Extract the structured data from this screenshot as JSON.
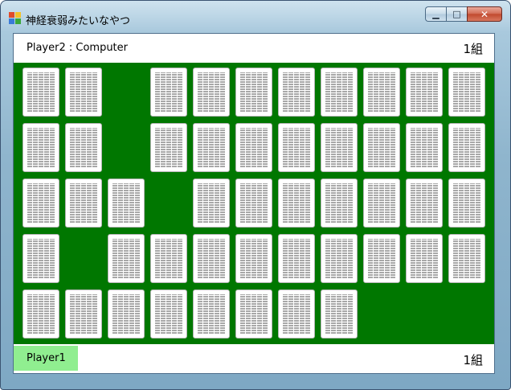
{
  "window": {
    "title": "神経衰弱みたいなやつ",
    "controls": {
      "minimize": "▁",
      "maximize": "□",
      "close": "✕"
    }
  },
  "top_bar": {
    "players_label": "Player2 : Computer",
    "pairs": "1組"
  },
  "bottom_bar": {
    "current_player": "Player1",
    "current_player_color": "#90ee90",
    "pairs": "1組"
  },
  "board": {
    "background_color": "#007700",
    "rows": 5,
    "cols": 11,
    "grid": [
      [
        1,
        1,
        0,
        1,
        1,
        1,
        1,
        1,
        1,
        1,
        1
      ],
      [
        1,
        1,
        0,
        1,
        1,
        1,
        1,
        1,
        1,
        1,
        1
      ],
      [
        1,
        1,
        1,
        0,
        1,
        1,
        1,
        1,
        1,
        1,
        1
      ],
      [
        1,
        0,
        1,
        1,
        1,
        1,
        1,
        1,
        1,
        1,
        1
      ],
      [
        1,
        1,
        1,
        1,
        1,
        1,
        1,
        1,
        0,
        0,
        0
      ]
    ]
  }
}
